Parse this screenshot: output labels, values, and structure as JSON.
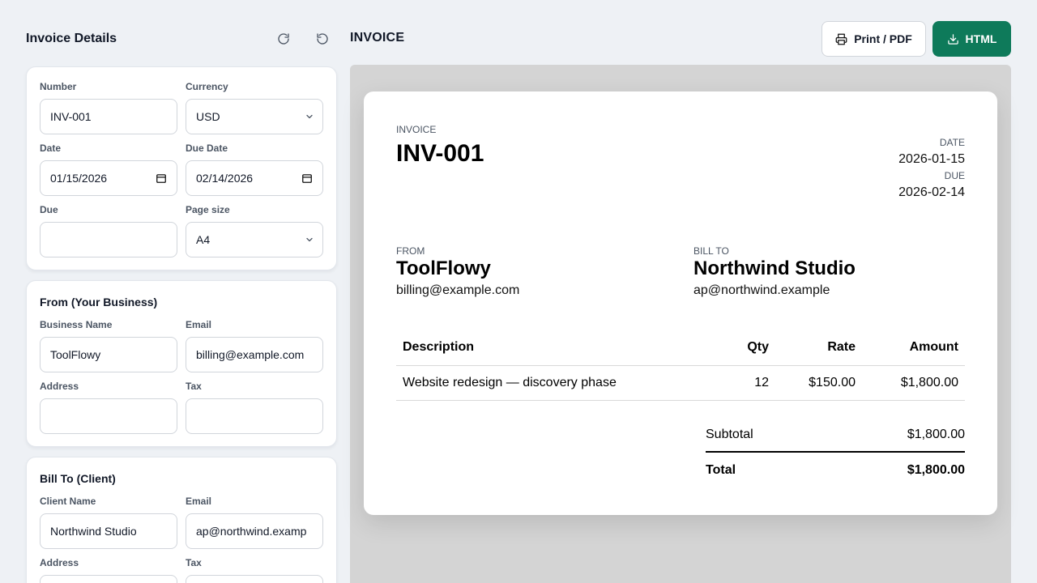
{
  "left_panel": {
    "title": "Invoice Details",
    "details": {
      "number": {
        "label": "Number",
        "value": "INV-001"
      },
      "currency": {
        "label": "Currency",
        "value": "USD"
      },
      "date": {
        "label": "Date",
        "value": "01/15/2026"
      },
      "due_date": {
        "label": "Due Date",
        "value": "02/14/2026"
      },
      "due": {
        "label": "Due",
        "value": ""
      },
      "page_size": {
        "label": "Page size",
        "value": "A4"
      }
    },
    "from": {
      "title": "From (Your Business)",
      "business_name": {
        "label": "Business Name",
        "value": "ToolFlowy"
      },
      "email": {
        "label": "Email",
        "value": "billing@example.com"
      },
      "address": {
        "label": "Address",
        "value": ""
      },
      "tax": {
        "label": "Tax",
        "value": ""
      }
    },
    "bill_to": {
      "title": "Bill To (Client)",
      "client_name": {
        "label": "Client Name",
        "value": "Northwind Studio"
      },
      "email": {
        "label": "Email",
        "value": "ap@northwind.examp"
      },
      "address": {
        "label": "Address",
        "value": ""
      },
      "tax": {
        "label": "Tax",
        "value": ""
      }
    }
  },
  "right_panel": {
    "title": "INVOICE",
    "print_label": "Print / PDF",
    "html_label": "HTML",
    "accent_color": "#0e7a5a"
  },
  "invoice": {
    "kicker": "INVOICE",
    "number": "INV-001",
    "date_label": "DATE",
    "date": "2026-01-15",
    "due_label": "DUE",
    "due": "2026-02-14",
    "from_label": "FROM",
    "from_name": "ToolFlowy",
    "from_email": "billing@example.com",
    "bill_to_label": "BILL TO",
    "bill_to_name": "Northwind Studio",
    "bill_to_email": "ap@northwind.example",
    "columns": [
      "Description",
      "Qty",
      "Rate",
      "Amount"
    ],
    "items": [
      {
        "description": "Website redesign — discovery phase",
        "qty": "12",
        "rate": "$150.00",
        "amount": "$1,800.00"
      }
    ],
    "subtotal_label": "Subtotal",
    "subtotal": "$1,800.00",
    "total_label": "Total",
    "total": "$1,800.00"
  }
}
